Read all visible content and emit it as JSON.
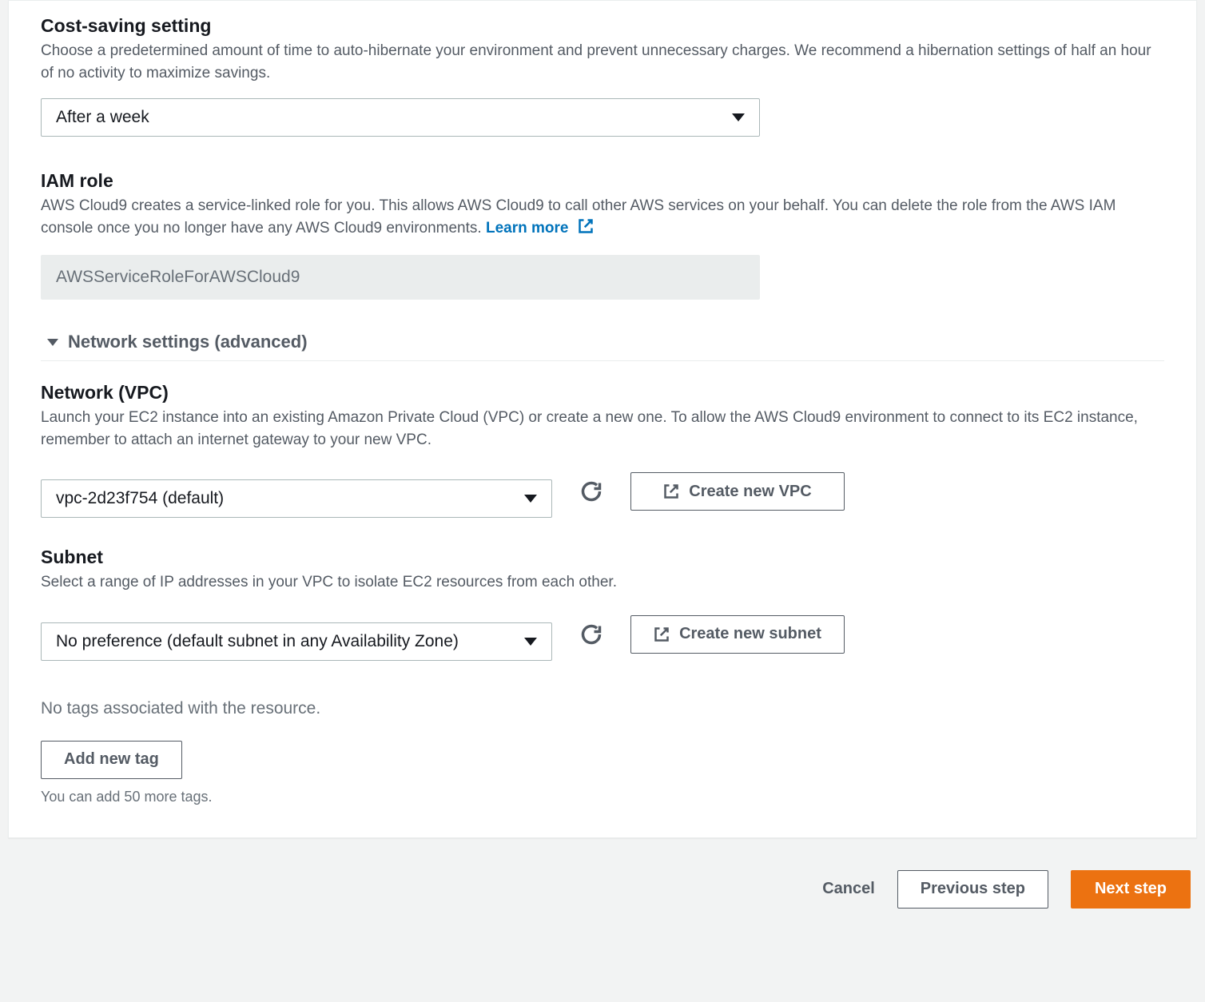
{
  "costSaving": {
    "title": "Cost-saving setting",
    "desc": "Choose a predetermined amount of time to auto-hibernate your environment and prevent unnecessary charges. We recommend a hibernation settings of half an hour of no activity to maximize savings.",
    "selected": "After a week"
  },
  "iamRole": {
    "title": "IAM role",
    "desc": "AWS Cloud9 creates a service-linked role for you. This allows AWS Cloud9 to call other AWS services on your behalf. You can delete the role from the AWS IAM console once you no longer have any AWS Cloud9 environments. ",
    "learnMore": "Learn more",
    "value": "AWSServiceRoleForAWSCloud9"
  },
  "networkSettings": {
    "header": "Network settings (advanced)"
  },
  "networkVpc": {
    "title": "Network (VPC)",
    "desc": "Launch your EC2 instance into an existing Amazon Private Cloud (VPC) or create a new one. To allow the AWS Cloud9 environment to connect to its EC2 instance, remember to attach an internet gateway to your new VPC.",
    "selected": "vpc-2d23f754 (default)",
    "createBtn": "Create new VPC"
  },
  "subnet": {
    "title": "Subnet",
    "desc": "Select a range of IP addresses in your VPC to isolate EC2 resources from each other.",
    "selected": "No preference (default subnet in any Availability Zone)",
    "createBtn": "Create new subnet"
  },
  "tags": {
    "noTags": "No tags associated with the resource.",
    "addBtn": "Add new tag",
    "hint": "You can add 50 more tags."
  },
  "footer": {
    "cancel": "Cancel",
    "prev": "Previous step",
    "next": "Next step"
  }
}
